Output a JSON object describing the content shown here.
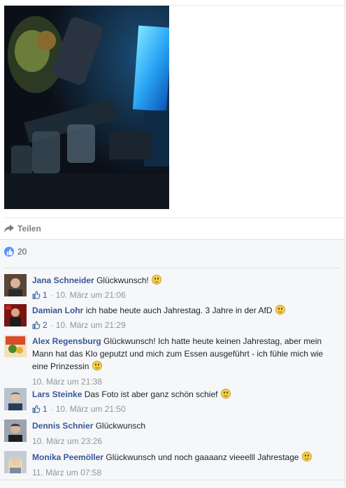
{
  "post": {
    "share_label": "Teilen",
    "like_count": "20"
  },
  "colors": {
    "link": "#365899",
    "meta": "#90949c",
    "like_blue": "#5890ff"
  },
  "comments": [
    {
      "author": "Jana Schneider",
      "text": "Glückwunsch!",
      "emoji": "smile-emoji",
      "likes": "1",
      "separator": "·",
      "time": "10. März um 21:06"
    },
    {
      "author": "Damian Lohr",
      "text": "ich habe heute auch Jahrestag. 3 Jahre in der AfD",
      "emoji": "grin-emoji",
      "likes": "2",
      "separator": "·",
      "time": "10. März um 21:29"
    },
    {
      "author": "Alex Regensburg",
      "text": "Glückwunsch! Ich hatte heute keinen Jahrestag, aber mein Mann hat das Klo geputzt und mich zum Essen ausgeführt - ich fühle mich wie eine Prinzessin",
      "emoji": "smile-emoji",
      "likes": "",
      "separator": "",
      "time": "10. März um 21:38"
    },
    {
      "author": "Lars Steinke",
      "text": "Das Foto ist aber ganz schön schief",
      "emoji": "grin-emoji",
      "likes": "1",
      "separator": "·",
      "time": "10. März um 21:50"
    },
    {
      "author": "Dennis Schnier",
      "text": "Glückwunsch",
      "emoji": "",
      "likes": "",
      "separator": "",
      "time": "10. März um 23:26"
    },
    {
      "author": "Monika Peemöller",
      "text": "Glückwunsch und noch gaaaanz vieeelll Jahrestage",
      "emoji": "smile-emoji",
      "likes": "",
      "separator": "",
      "time": "11. März um 07:58"
    }
  ]
}
